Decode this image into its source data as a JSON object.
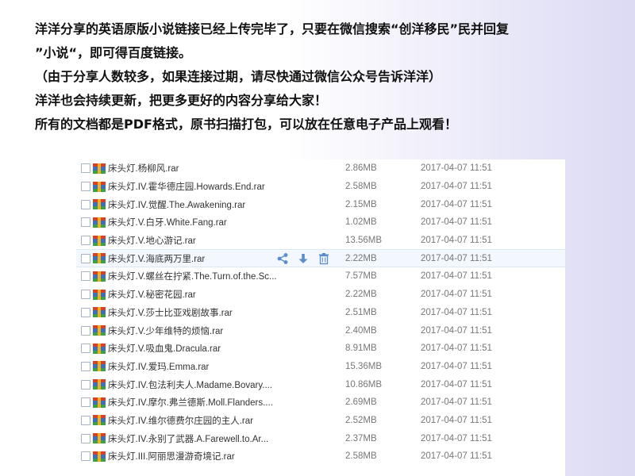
{
  "intro": {
    "line1": "洋洋分享的英语原版小说链接已经上传完毕了，只要在微信搜索“创洋移民”民并回复",
    "line2": "”小说“，即可得百度链接。",
    "line3": "（由于分享人数较多，如果连接过期，请尽快通过微信公众号告诉洋洋）",
    "line4": "洋洋也会持续更新，把更多更好的内容分享给大家！",
    "line5": "所有的文档都是PDF格式，原书扫描打包，可以放在任意电子产品上观看！"
  },
  "files": [
    {
      "name": "床头灯.杨柳风.rar",
      "size": "2.86MB",
      "date": "2017-04-07 11:51"
    },
    {
      "name": "床头灯.IV.霍华德庄园.Howards.End.rar",
      "size": "2.58MB",
      "date": "2017-04-07 11:51"
    },
    {
      "name": "床头灯.IV.觉醒.The.Awakening.rar",
      "size": "2.15MB",
      "date": "2017-04-07 11:51"
    },
    {
      "name": "床头灯.V.白牙.White.Fang.rar",
      "size": "1.02MB",
      "date": "2017-04-07 11:51"
    },
    {
      "name": "床头灯.V.地心游记.rar",
      "size": "13.56MB",
      "date": "2017-04-07 11:51"
    },
    {
      "name": "床头灯.V.海底两万里.rar",
      "size": "2.22MB",
      "date": "2017-04-07 11:51"
    },
    {
      "name": "床头灯.V.螺丝在拧紧.The.Turn.of.the.Sc...",
      "size": "7.57MB",
      "date": "2017-04-07 11:51"
    },
    {
      "name": "床头灯.V.秘密花园.rar",
      "size": "2.22MB",
      "date": "2017-04-07 11:51"
    },
    {
      "name": "床头灯.V.莎士比亚戏剧故事.rar",
      "size": "2.51MB",
      "date": "2017-04-07 11:51"
    },
    {
      "name": "床头灯.V.少年维特的烦恼.rar",
      "size": "2.40MB",
      "date": "2017-04-07 11:51"
    },
    {
      "name": "床头灯.V.吸血鬼.Dracula.rar",
      "size": "8.91MB",
      "date": "2017-04-07 11:51"
    },
    {
      "name": "床头灯.IV.爱玛.Emma.rar",
      "size": "15.36MB",
      "date": "2017-04-07 11:51"
    },
    {
      "name": "床头灯.IV.包法利夫人.Madame.Bovary....",
      "size": "10.86MB",
      "date": "2017-04-07 11:51"
    },
    {
      "name": "床头灯.IV.摩尔.弗兰德斯.Moll.Flanders....",
      "size": "2.69MB",
      "date": "2017-04-07 11:51"
    },
    {
      "name": "床头灯.IV.维尔德费尔庄园的主人.rar",
      "size": "2.52MB",
      "date": "2017-04-07 11:51"
    },
    {
      "name": "床头灯.IV.永别了武器.A.Farewell.to.Ar...",
      "size": "2.37MB",
      "date": "2017-04-07 11:51"
    },
    {
      "name": "床头灯.III.阿丽思漫游奇境记.rar",
      "size": "2.58MB",
      "date": "2017-04-07 11:51"
    }
  ],
  "hover_row_index": 5,
  "row_actions": [
    "share-icon",
    "download-icon",
    "delete-icon"
  ],
  "colors": {
    "accent": "#5a8ecb",
    "file_icon_red": "#d9402a",
    "file_icon_blue": "#3b6fc4",
    "file_icon_yellow": "#f2b21b",
    "file_icon_green": "#3aa04a"
  }
}
